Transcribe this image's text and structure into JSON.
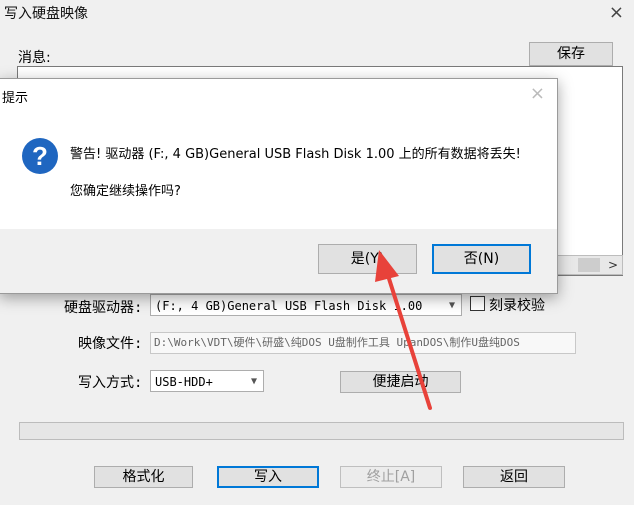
{
  "main": {
    "title": "写入硬盘映像",
    "close_glyph": "×",
    "messages_label": "消息:",
    "save_label": "保存",
    "drive_label": "硬盘驱动器:",
    "drive_value": "(F:, 4 GB)General USB Flash Disk  1.00",
    "verify_label": "刻录校验",
    "image_label": "映像文件:",
    "image_path": "D:\\Work\\VDT\\硬件\\研盛\\纯DOS U盘制作工具 UpanDOS\\制作U盘纯DOS",
    "write_mode_label": "写入方式:",
    "write_mode_value": "USB-HDD+",
    "quick_boot_label": "便捷启动",
    "format_label": "格式化",
    "write_label": "写入",
    "abort_label": "终止[A]",
    "back_label": "返回"
  },
  "dialog": {
    "title": "提示",
    "close_glyph": "×",
    "icon_glyph": "?",
    "warning_text": "警告! 驱动器 (F:, 4 GB)General USB Flash Disk  1.00 上的所有数据将丢失!",
    "confirm_text": "您确定继续操作吗?",
    "yes_label": "是(Y)",
    "no_label": "否(N)"
  },
  "colors": {
    "annotation_arrow": "#e8423a",
    "focus_border": "#0078d7",
    "question_icon": "#1f66c0"
  }
}
